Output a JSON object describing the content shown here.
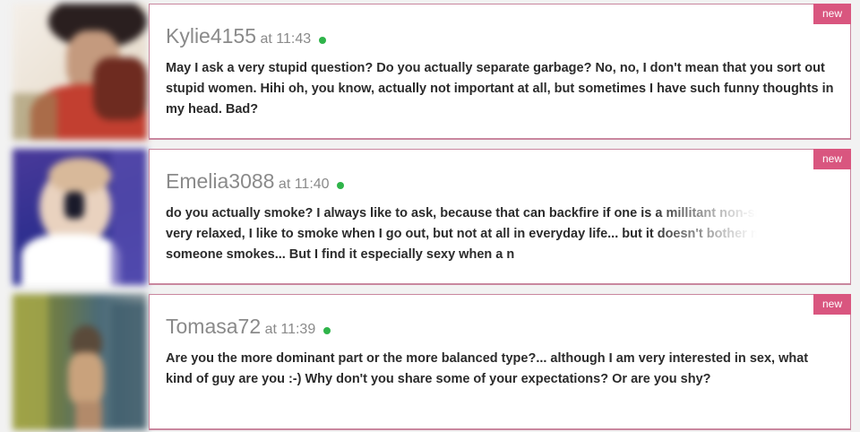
{
  "messages": [
    {
      "username": "Kylie4155",
      "at": "at",
      "time": "11:43",
      "online": true,
      "badge": "new",
      "text": "May I ask a very stupid question? Do you actually separate garbage? No, no, I don't mean that you sort out stupid women. Hihi oh, you know, actually not important at all, but sometimes I have such funny thoughts in my head. Bad?",
      "avatar_colors": [
        "#f4efe9",
        "#6e2b20",
        "#c23f30",
        "#2a1f1f"
      ]
    },
    {
      "username": "Emelia3088",
      "at": "at",
      "time": "11:40",
      "online": true,
      "badge": "new",
      "text": "do you actually smoke? I always like to ask, because that can backfire if one is a millitant non-smoker... I'm very relaxed, I like to smoke when I go out, but not at all in everyday life... but it doesn't bother me when someone smokes... But I find it especially sexy when a n",
      "avatar_colors": [
        "#2f2f8f",
        "#e9d2bf",
        "#ffffff",
        "#4a3a9a"
      ]
    },
    {
      "username": "Tomasa72",
      "at": "at",
      "time": "11:39",
      "online": true,
      "badge": "new",
      "text": "Are you the more dominant part or the more balanced type?... although I am very interested in sex, what kind of guy are you :-) Why don't you share some of your expectations? Or are you shy?",
      "avatar_colors": [
        "#8a8f3a",
        "#4a6a78",
        "#c9a27c",
        "#6b7a4a"
      ]
    }
  ],
  "colors": {
    "badge": "#d9567f",
    "card_border": "#c9879f",
    "online": "#2fb44a",
    "username": "#8a8a8a",
    "text": "#2b2b2b"
  }
}
